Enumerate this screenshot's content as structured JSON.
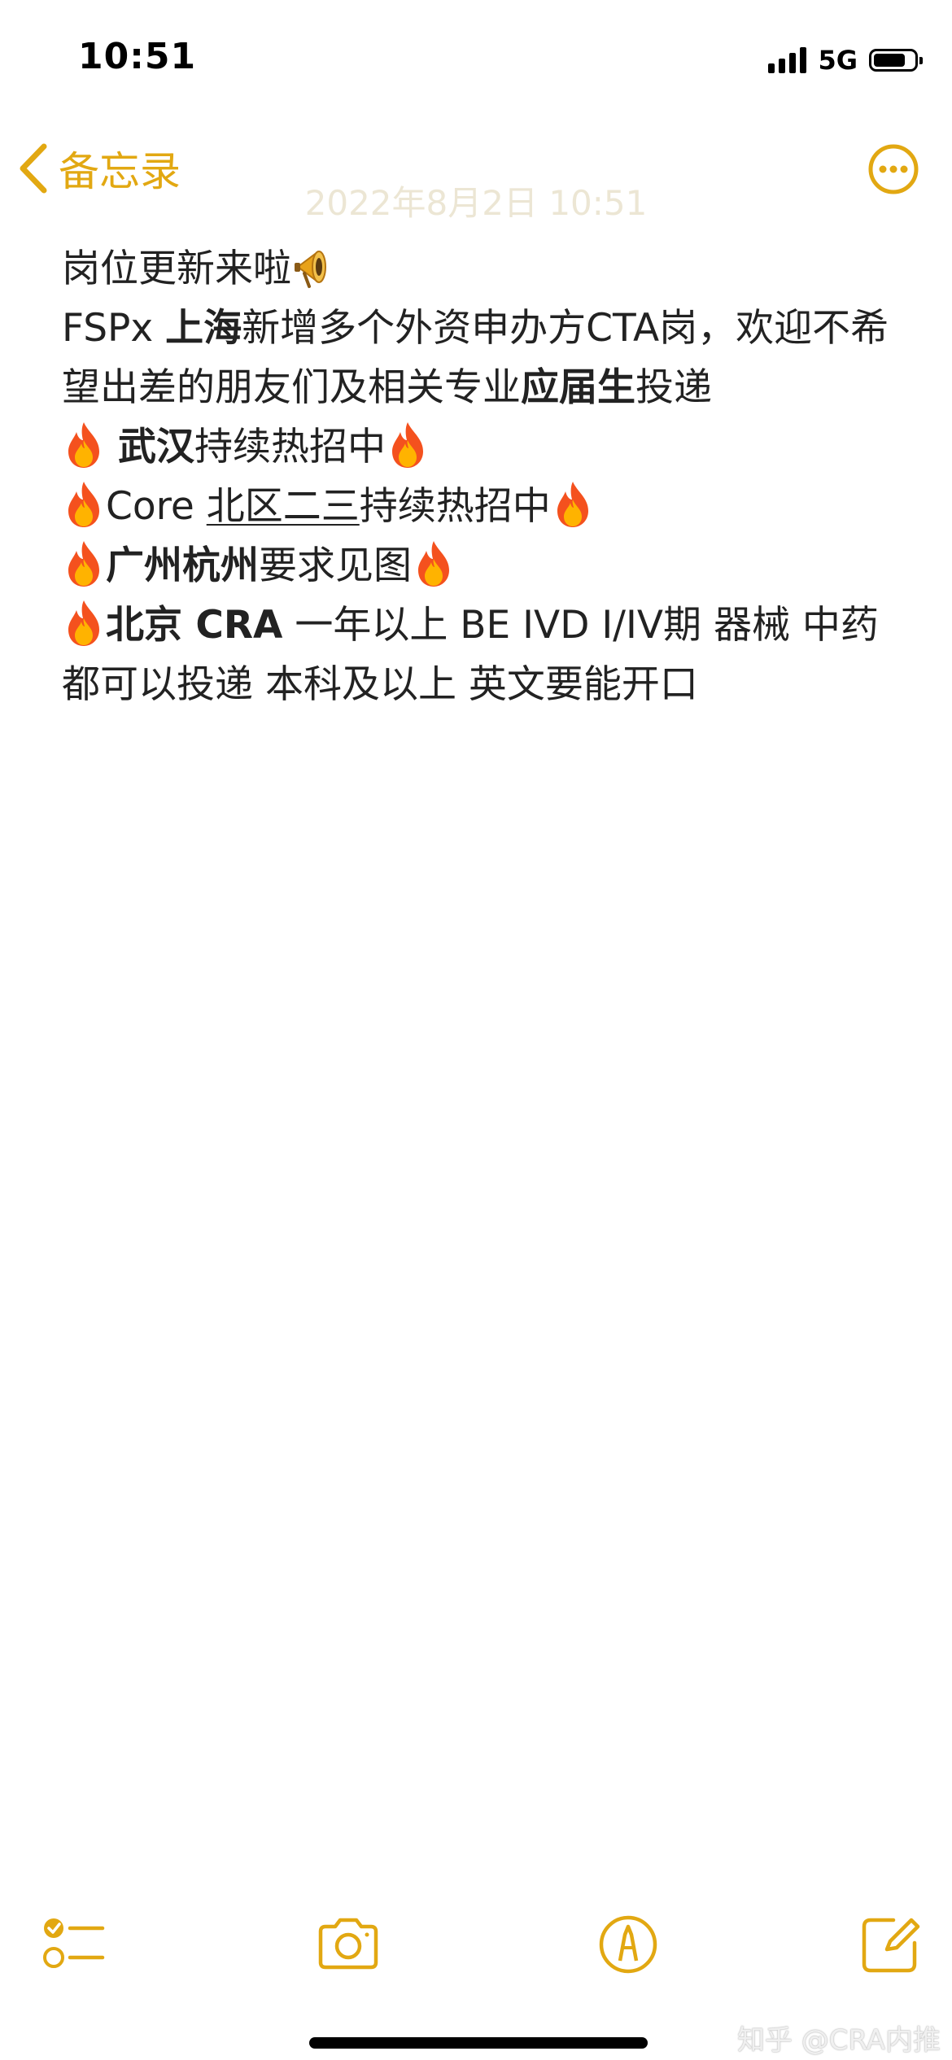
{
  "status_bar": {
    "time": "10:51",
    "network": "5G"
  },
  "nav": {
    "back_label": "备忘录",
    "more_icon": "ellipsis-circle-icon"
  },
  "note": {
    "date": "2022年8月2日 10:51",
    "lines": {
      "l1": {
        "text": "岗位更新来啦"
      },
      "l2": {
        "a": "FSPx ",
        "b": "上海",
        "c": "新增多个外资申办方CTA岗，欢迎不希望出差的朋友们及相关专业",
        "d": "应届生",
        "e": "投递"
      },
      "l3": {
        "a": "武汉",
        "b": "持续热招中"
      },
      "l4": {
        "a": "Core ",
        "b": "北区二三",
        "c": "持续热招中"
      },
      "l5": {
        "a": "广州杭州",
        "b": "要求见图"
      },
      "l6": {
        "a": "北京 CRA",
        "b": " 一年以上 BE IVD I/IV期 器械 中药 都可以投递 本科及以上 英文要能开口"
      }
    },
    "emojis": [
      "megaphone-emoji",
      "fire-emoji"
    ]
  },
  "toolbar": {
    "checklist_icon": "checklist-icon",
    "camera_icon": "camera-icon",
    "markup_icon": "markup-pen-icon",
    "compose_icon": "compose-icon"
  },
  "watermark": "知乎 @CRA内推",
  "colors": {
    "accent": "#e2a812",
    "text": "#222222",
    "background": "#ffffff"
  }
}
